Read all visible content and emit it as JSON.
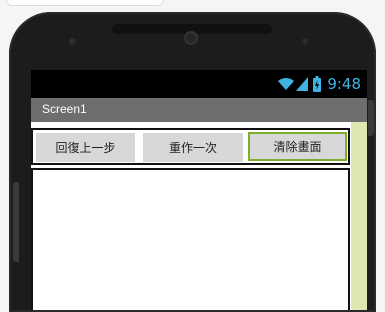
{
  "status_bar": {
    "time": "9:48",
    "icons": [
      "wifi-icon",
      "signal-icon",
      "battery-icon"
    ],
    "accent_color": "#3fb4e3"
  },
  "screen": {
    "title": "Screen1"
  },
  "buttons": [
    {
      "label": "回復上一步"
    },
    {
      "label": "重作一次"
    },
    {
      "label": "清除畫面"
    }
  ],
  "colors": {
    "title_bar": "#6e6e6e",
    "button_bg": "#d8d8d8",
    "focus_border": "#7fae2a",
    "side_strip": "#dfe6b2"
  }
}
